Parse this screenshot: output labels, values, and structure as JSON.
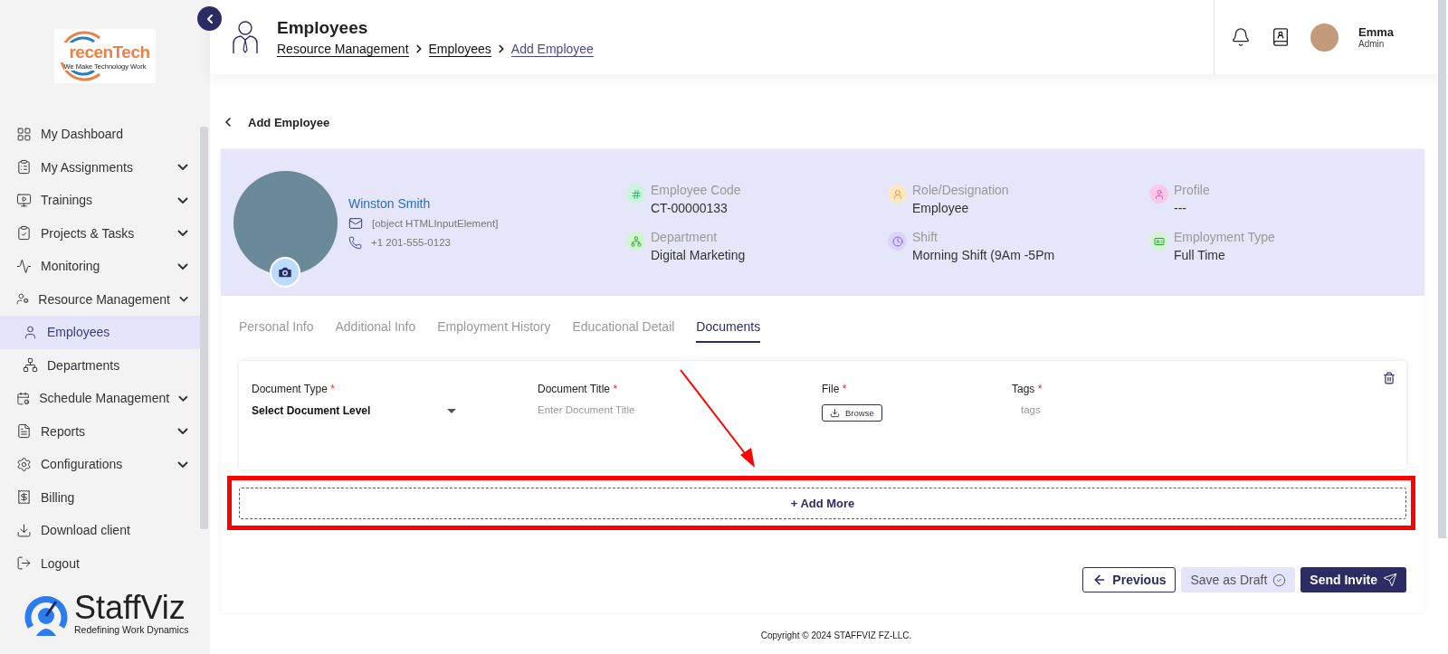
{
  "sidebar": {
    "logo": {
      "name": "recenTech",
      "tagline": "We Make Technology Work"
    },
    "items": [
      {
        "label": "My Dashboard",
        "expandable": false,
        "selected": false
      },
      {
        "label": "My Assignments",
        "expandable": true,
        "selected": false
      },
      {
        "label": "Trainings",
        "expandable": true,
        "selected": false
      },
      {
        "label": "Projects & Tasks",
        "expandable": true,
        "selected": false
      },
      {
        "label": "Monitoring",
        "expandable": true,
        "selected": false
      },
      {
        "label": "Resource Management",
        "expandable": true,
        "selected": false,
        "children": [
          {
            "label": "Employees",
            "expandable": false,
            "selected": true
          },
          {
            "label": "Departments",
            "expandable": false,
            "selected": false
          }
        ]
      },
      {
        "label": "Schedule Management",
        "expandable": true,
        "selected": false
      },
      {
        "label": "Reports",
        "expandable": true,
        "selected": false
      },
      {
        "label": "Configurations",
        "expandable": true,
        "selected": false
      },
      {
        "label": "Billing",
        "expandable": false,
        "selected": false
      },
      {
        "label": "Download client",
        "expandable": false,
        "selected": false
      },
      {
        "label": "Logout",
        "expandable": false,
        "selected": false
      }
    ],
    "brand": {
      "name": "StaffViz",
      "tagline": "Redefining Work Dynamics"
    }
  },
  "header": {
    "title": "Employees",
    "breadcrumb": [
      {
        "label": "Resource Management",
        "current": false
      },
      {
        "label": "Employees",
        "current": false
      },
      {
        "label": "Add Employee",
        "current": true
      }
    ],
    "user": {
      "name": "Emma",
      "role": "Admin"
    }
  },
  "page": {
    "back_label": "Add Employee"
  },
  "employee": {
    "name": "Winston Smith",
    "email": "[object HTMLInputElement]",
    "phone": "+1 201-555-0123",
    "details": [
      {
        "label": "Employee Code",
        "value": "CT-00000133",
        "color": "#c8f5dc"
      },
      {
        "label": "Role/Designation",
        "value": "Employee",
        "color": "#fde6c4"
      },
      {
        "label": "Profile",
        "value": "---",
        "color": "#f9c9e8"
      },
      {
        "label": "Department",
        "value": "Digital Marketing",
        "color": "#d2f5d0"
      },
      {
        "label": "Shift",
        "value": "Morning Shift (9Am -5Pm",
        "color": "#dcd4fa"
      },
      {
        "label": "Employment Type",
        "value": "Full Time",
        "color": "#d4f5d2"
      }
    ]
  },
  "tabs": [
    {
      "label": "Personal Info",
      "selected": false
    },
    {
      "label": "Additional Info",
      "selected": false
    },
    {
      "label": "Employment History",
      "selected": false
    },
    {
      "label": "Educational Detail",
      "selected": false
    },
    {
      "label": "Documents",
      "selected": true
    }
  ],
  "document_form": {
    "fields": [
      {
        "kind": "select",
        "label": "Document Type",
        "marker": "*",
        "value": "Select Document Level"
      },
      {
        "kind": "text",
        "label": "Document Title",
        "marker": "*",
        "placeholder": "Enter Document Title"
      },
      {
        "kind": "file",
        "label": "File",
        "marker": "*",
        "button": "Browse"
      },
      {
        "kind": "tags",
        "label": "Tags",
        "marker": "*",
        "placeholder": "tags"
      }
    ],
    "add_more": "+ Add More"
  },
  "actions": {
    "previous": "Previous",
    "draft": "Save as Draft",
    "send": "Send Invite"
  },
  "footer": {
    "copyright": "Copyright © 2024 STAFFVIZ FZ-LLC."
  }
}
